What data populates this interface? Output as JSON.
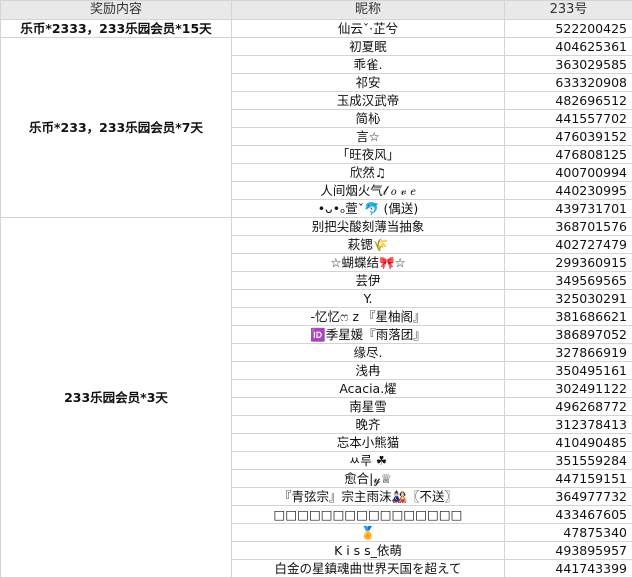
{
  "headers": [
    "奖励内容",
    "昵称",
    "233号"
  ],
  "groups": [
    {
      "reward": "乐币*2333，233乐园会员*15天",
      "rows": [
        {
          "nick": "仙云ˇ·芷兮",
          "id": "522200425"
        }
      ]
    },
    {
      "reward": "乐币*233，233乐园会员*7天",
      "rows": [
        {
          "nick": "初夏眠",
          "id": "404625361"
        },
        {
          "nick": "乖雀.",
          "id": "363029585"
        },
        {
          "nick": "祁安",
          "id": "633320908"
        },
        {
          "nick": "玉成汉武帝",
          "id": "482696512"
        },
        {
          "nick": "简杺",
          "id": "441557702"
        },
        {
          "nick": "言☆",
          "id": "476039152"
        },
        {
          "nick": "「旺夜风」",
          "id": "476808125"
        },
        {
          "nick": "欣然♫",
          "id": "400700994"
        },
        {
          "nick": "人间烟火气𝓁 𝑜 𝓋 𝑒",
          "id": "440230995"
        },
        {
          "nick": "•ᴗ•ₒ萱ˇ🐬 (偶送)",
          "id": "439731701"
        }
      ]
    },
    {
      "reward": "233乐园会员*3天",
      "rows": [
        {
          "nick": "别把尖酸刻薄当抽象",
          "id": "368701576"
        },
        {
          "nick": "萩锶🌾",
          "id": "402727479"
        },
        {
          "nick": "☆蝴蝶结🎀☆",
          "id": "299360915"
        },
        {
          "nick": "芸伊",
          "id": "349569565"
        },
        {
          "nick": "Y.",
          "id": "325030291"
        },
        {
          "nick": "-忆忆ෆ 𝗓 『星柚阁』",
          "id": "381686621"
        },
        {
          "nick": "🆔季星媛『雨落团』",
          "id": "386897052"
        },
        {
          "nick": "缘尽.",
          "id": "327866919"
        },
        {
          "nick": "浅冉",
          "id": "350495161"
        },
        {
          "nick": "Acacia.燿",
          "id": "302491122"
        },
        {
          "nick": "南星雪",
          "id": "496268772"
        },
        {
          "nick": "晚齐",
          "id": "312378413"
        },
        {
          "nick": "忘本小熊猫",
          "id": "410490485"
        },
        {
          "nick": "ㅆ루 ☘",
          "id": "351559284"
        },
        {
          "nick": "愈合|𝓎♕",
          "id": "447159151"
        },
        {
          "nick": "『青弦宗』宗主雨沫🎎〖不送〗",
          "id": "364977732"
        },
        {
          "nick": "□□□□□□□□□□□□□□□□",
          "id": "433467605"
        },
        {
          "nick": "🏅",
          "id": "47875340"
        },
        {
          "nick": "K i s s_依萌",
          "id": "493895957"
        },
        {
          "nick": "白金の星鎮魂曲世界天国を超えて",
          "id": "441743399"
        }
      ]
    }
  ]
}
